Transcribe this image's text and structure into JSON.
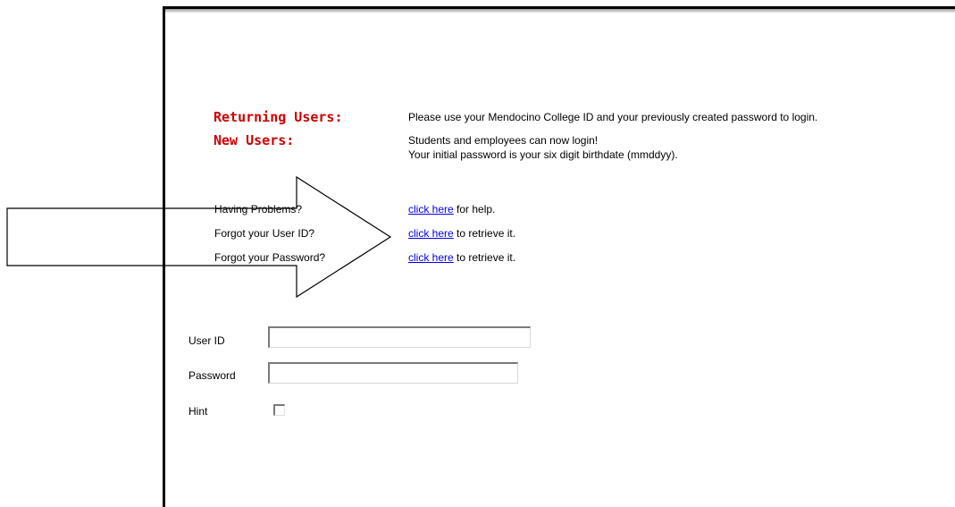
{
  "info": {
    "returning_heading": "Returning Users:",
    "returning_text": "Please use your Mendocino College ID and your previously created password to login.",
    "new_heading": "New Users:",
    "new_line1": "Students and employees can now login!",
    "new_line2": "Your initial password is your six digit birthdate (mmddyy)."
  },
  "help": {
    "problems_label": "Having Problems?",
    "problems_link": "click here",
    "problems_suffix": " for help.",
    "userid_label": "Forgot your User ID?",
    "userid_link": "click here",
    "userid_suffix": " to retrieve it.",
    "password_label": "Forgot your Password?",
    "password_link": "click here",
    "password_suffix": " to retrieve it."
  },
  "form": {
    "userid_label": "User ID",
    "userid_value": "",
    "password_label": "Password",
    "password_value": "",
    "hint_label": "Hint",
    "hint_checked": false
  },
  "annotation": {
    "icon": "arrow-right-icon",
    "color": "#000000"
  }
}
